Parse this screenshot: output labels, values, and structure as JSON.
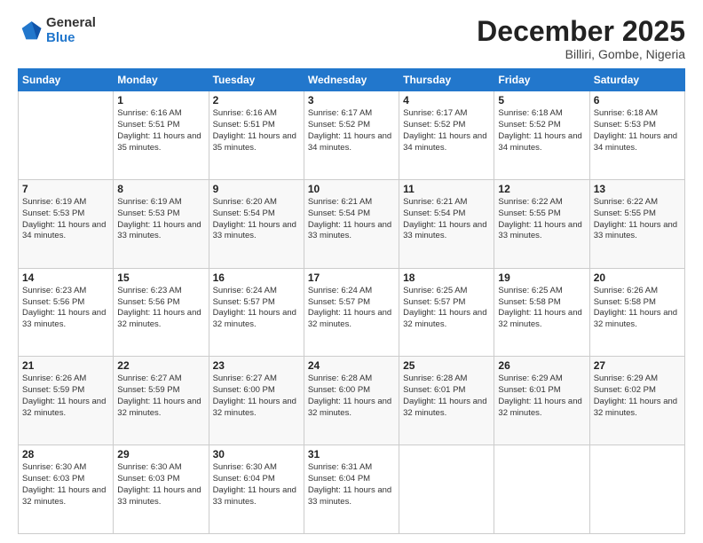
{
  "logo": {
    "general": "General",
    "blue": "Blue"
  },
  "header": {
    "month": "December 2025",
    "location": "Billiri, Gombe, Nigeria"
  },
  "weekdays": [
    "Sunday",
    "Monday",
    "Tuesday",
    "Wednesday",
    "Thursday",
    "Friday",
    "Saturday"
  ],
  "weeks": [
    [
      {
        "day": "",
        "empty": true
      },
      {
        "day": "1",
        "sunrise": "6:16 AM",
        "sunset": "5:51 PM",
        "daylight": "11 hours and 35 minutes."
      },
      {
        "day": "2",
        "sunrise": "6:16 AM",
        "sunset": "5:51 PM",
        "daylight": "11 hours and 35 minutes."
      },
      {
        "day": "3",
        "sunrise": "6:17 AM",
        "sunset": "5:52 PM",
        "daylight": "11 hours and 34 minutes."
      },
      {
        "day": "4",
        "sunrise": "6:17 AM",
        "sunset": "5:52 PM",
        "daylight": "11 hours and 34 minutes."
      },
      {
        "day": "5",
        "sunrise": "6:18 AM",
        "sunset": "5:52 PM",
        "daylight": "11 hours and 34 minutes."
      },
      {
        "day": "6",
        "sunrise": "6:18 AM",
        "sunset": "5:53 PM",
        "daylight": "11 hours and 34 minutes."
      }
    ],
    [
      {
        "day": "7",
        "sunrise": "6:19 AM",
        "sunset": "5:53 PM",
        "daylight": "11 hours and 34 minutes."
      },
      {
        "day": "8",
        "sunrise": "6:19 AM",
        "sunset": "5:53 PM",
        "daylight": "11 hours and 33 minutes."
      },
      {
        "day": "9",
        "sunrise": "6:20 AM",
        "sunset": "5:54 PM",
        "daylight": "11 hours and 33 minutes."
      },
      {
        "day": "10",
        "sunrise": "6:21 AM",
        "sunset": "5:54 PM",
        "daylight": "11 hours and 33 minutes."
      },
      {
        "day": "11",
        "sunrise": "6:21 AM",
        "sunset": "5:54 PM",
        "daylight": "11 hours and 33 minutes."
      },
      {
        "day": "12",
        "sunrise": "6:22 AM",
        "sunset": "5:55 PM",
        "daylight": "11 hours and 33 minutes."
      },
      {
        "day": "13",
        "sunrise": "6:22 AM",
        "sunset": "5:55 PM",
        "daylight": "11 hours and 33 minutes."
      }
    ],
    [
      {
        "day": "14",
        "sunrise": "6:23 AM",
        "sunset": "5:56 PM",
        "daylight": "11 hours and 33 minutes."
      },
      {
        "day": "15",
        "sunrise": "6:23 AM",
        "sunset": "5:56 PM",
        "daylight": "11 hours and 32 minutes."
      },
      {
        "day": "16",
        "sunrise": "6:24 AM",
        "sunset": "5:57 PM",
        "daylight": "11 hours and 32 minutes."
      },
      {
        "day": "17",
        "sunrise": "6:24 AM",
        "sunset": "5:57 PM",
        "daylight": "11 hours and 32 minutes."
      },
      {
        "day": "18",
        "sunrise": "6:25 AM",
        "sunset": "5:57 PM",
        "daylight": "11 hours and 32 minutes."
      },
      {
        "day": "19",
        "sunrise": "6:25 AM",
        "sunset": "5:58 PM",
        "daylight": "11 hours and 32 minutes."
      },
      {
        "day": "20",
        "sunrise": "6:26 AM",
        "sunset": "5:58 PM",
        "daylight": "11 hours and 32 minutes."
      }
    ],
    [
      {
        "day": "21",
        "sunrise": "6:26 AM",
        "sunset": "5:59 PM",
        "daylight": "11 hours and 32 minutes."
      },
      {
        "day": "22",
        "sunrise": "6:27 AM",
        "sunset": "5:59 PM",
        "daylight": "11 hours and 32 minutes."
      },
      {
        "day": "23",
        "sunrise": "6:27 AM",
        "sunset": "6:00 PM",
        "daylight": "11 hours and 32 minutes."
      },
      {
        "day": "24",
        "sunrise": "6:28 AM",
        "sunset": "6:00 PM",
        "daylight": "11 hours and 32 minutes."
      },
      {
        "day": "25",
        "sunrise": "6:28 AM",
        "sunset": "6:01 PM",
        "daylight": "11 hours and 32 minutes."
      },
      {
        "day": "26",
        "sunrise": "6:29 AM",
        "sunset": "6:01 PM",
        "daylight": "11 hours and 32 minutes."
      },
      {
        "day": "27",
        "sunrise": "6:29 AM",
        "sunset": "6:02 PM",
        "daylight": "11 hours and 32 minutes."
      }
    ],
    [
      {
        "day": "28",
        "sunrise": "6:30 AM",
        "sunset": "6:03 PM",
        "daylight": "11 hours and 32 minutes."
      },
      {
        "day": "29",
        "sunrise": "6:30 AM",
        "sunset": "6:03 PM",
        "daylight": "11 hours and 33 minutes."
      },
      {
        "day": "30",
        "sunrise": "6:30 AM",
        "sunset": "6:04 PM",
        "daylight": "11 hours and 33 minutes."
      },
      {
        "day": "31",
        "sunrise": "6:31 AM",
        "sunset": "6:04 PM",
        "daylight": "11 hours and 33 minutes."
      },
      {
        "day": "",
        "empty": true
      },
      {
        "day": "",
        "empty": true
      },
      {
        "day": "",
        "empty": true
      }
    ]
  ],
  "labels": {
    "sunrise": "Sunrise:",
    "sunset": "Sunset:",
    "daylight": "Daylight:"
  }
}
